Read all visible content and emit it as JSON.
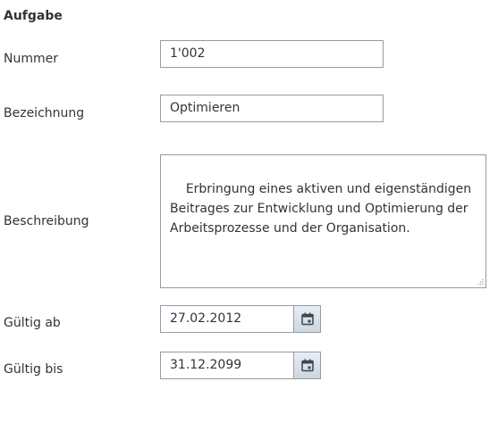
{
  "section": {
    "title": "Aufgabe"
  },
  "fields": {
    "nummer": {
      "label": "Nummer",
      "value": "1'002"
    },
    "bezeichnung": {
      "label": "Bezeichnung",
      "value": "Optimieren"
    },
    "beschreibung": {
      "label": "Beschreibung",
      "value": "Erbringung eines aktiven und eigenständigen Beitrages zur Entwicklung und Optimierung der Arbeitsprozesse und der Organisation."
    },
    "gueltig_ab": {
      "label": "Gültig ab",
      "value": "27.02.2012",
      "button_icon": "calendar-icon"
    },
    "gueltig_bis": {
      "label": "Gültig bis",
      "value": "31.12.2099",
      "button_icon": "calendar-icon"
    }
  },
  "colors": {
    "text": "#333333",
    "border": "#8f9daa",
    "button_gradient_top": "#e9eef3",
    "button_gradient_bottom": "#cdd6de"
  }
}
